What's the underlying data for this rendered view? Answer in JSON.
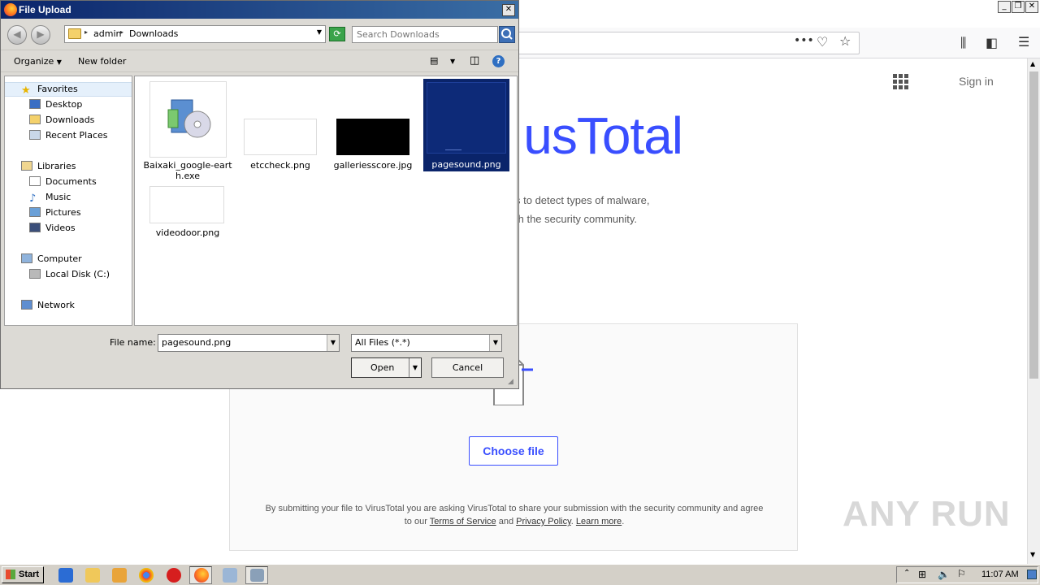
{
  "dialog": {
    "title": "File Upload",
    "close_glyph": "✕",
    "breadcrumb": [
      "admin",
      "Downloads"
    ],
    "search_placeholder": "Search Downloads",
    "commands": {
      "organize": "Organize",
      "new_folder": "New folder"
    },
    "help_glyph": "?",
    "nav": {
      "favorites": "Favorites",
      "desktop": "Desktop",
      "downloads": "Downloads",
      "recent_places": "Recent Places",
      "libraries": "Libraries",
      "documents": "Documents",
      "music": "Music",
      "pictures": "Pictures",
      "videos": "Videos",
      "computer": "Computer",
      "local_disk": "Local Disk (C:)",
      "network": "Network"
    },
    "files": {
      "f1": "Baixaki_google-eart\nh.exe",
      "f2": "etccheck.png",
      "f3": "galleriesscore.jpg",
      "f4": "pagesound.png",
      "f5": "videodoor.png"
    },
    "selected_file": "pagesound.png",
    "file_name_label": "File name:",
    "file_name_value": "pagesound.png",
    "file_type_value": "All Files (*.*)",
    "open_label": "Open",
    "cancel_label": "Cancel"
  },
  "browser": {
    "menu_glyph": "•••",
    "sign_in": "Sign in",
    "logo_text": "usTotal",
    "desc_line1": "s to detect types of malware,",
    "desc_line2": "th the security community.",
    "choose_file": "Choose file",
    "legal_pre": "By submitting your file to VirusTotal you are asking VirusTotal to share your submission with the security community and agree to our ",
    "terms": "Terms of Service",
    "and": " and ",
    "privacy": "Privacy Policy",
    "learn_more": "Learn more",
    "watermark": "ANY RUN"
  },
  "taskbar": {
    "start_label": "Start",
    "clock": "11:07 AM"
  },
  "colors": {
    "vt_blue": "#394eff",
    "dialog_bg": "#dcdad5",
    "selection": "#0a246a"
  }
}
